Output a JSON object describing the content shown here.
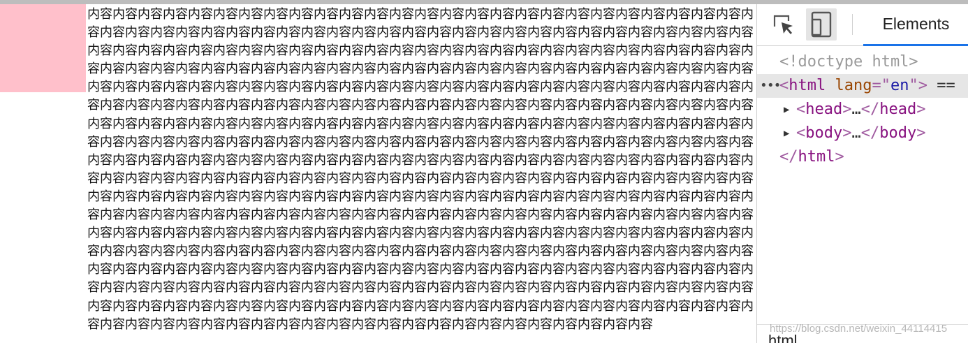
{
  "page": {
    "content_text": "内容内容内容内容内容内容内容内容内容内容内容内容内容内容内容内容内容内容内容内容内容内容内容内容内容内容内容内容内容内容内容内容内容内容内容内容内容内容内容内容内容内容内容内容内容内容内容内容内容内容内容内容内容内容内容内容内容内容内容内容内容内容内容内容内容内容内容内容内容内容内容内容内容内容内容内容内容内容内容内容内容内容内容内容内容内容内容内容内容内容内容内容内容内容内容内容内容内容内容内容内容内容内容内容内容内容内容内容内容内容内容内容内容内容内容内容内容内容内容内容内容内容内容内容内容内容内容内容内容内容内容内容内容内容内容内容内容内容内容内容内容内容内容内容内容内容内容内容内容内容内容内容内容内容内容内容内容内容内容内容内容内容内容内容内容内容内容内容内容内容内容内容内容内容内容内容内容内容内容内容内容内容内容内容内容内容内容内容内容内容内容内容内容内容内容内容内容内容内容内容内容内容内容内容内容内容内容内容内容内容内容内容内容内容内容内容内容内容内容内容内容内容内容内容内容内容内容内容内容内容内容内容内容内容内容内容内容内容内容内容内容内容内容内容内容内容内容内容内容内容内容内容内容内容内容内容内容内容内容内容内容内容内容内容内容内容内容内容内容内容内容内容内容内容内容内容内容内容内容内容内容内容内容内容内容内容内容内容内容内容内容内容内容内容内容内容内容内容内容内容内容内容内容内容内容内容内容内容内容内容内容内容内容内容内容内容内容内容内容内容内容内容内容内容内容内容内容内容内容内容内容内容内容内容内容内容内容内容内容内容内容内容内容内容内容内容内容内容内容内容内容内容内容内容内容内容内容内容内容内容内容内容内容内容内容内容内容内容内容内容内容内容内容内容内容内容内容内容内容内容内容内容内容内容内容内容内容内容内容内容内容内容内容内容内容内容内容内容内容内容内容内容内容内容内容内容内容内容内容内容内容内容内容内容内容内容内容内容内容内容内容内容内容内容内容内容内容内容内容内容内容内容内容内容内容内容内容内容内容内容内容内容内容内容内容内容内容内容内容内容内容内容内容内容内容内容内容内容内容内容内容内容内容内容内容内容内容内容内容内容内容内容内容",
    "pink_box_color": "#ffc0cb"
  },
  "devtools": {
    "inspect_icon": "inspect-element-icon",
    "device_icon": "device-toolbar-icon",
    "active_tab": "Elements",
    "tree": {
      "doctype": "<!doctype html>",
      "html_open_tag": "html",
      "lang_attr": "lang",
      "lang_value": "en",
      "eqeq": "==",
      "head_tag": "head",
      "body_tag": "body",
      "html_close_tag": "html",
      "ellipsis": "…"
    },
    "breadcrumb": "html"
  },
  "watermark": "https://blog.csdn.net/weixin_44114415",
  "colors": {
    "tag": "#881280",
    "attr_name": "#994500",
    "attr_value": "#1a1aa6",
    "tab_underline": "#1a73e8"
  }
}
